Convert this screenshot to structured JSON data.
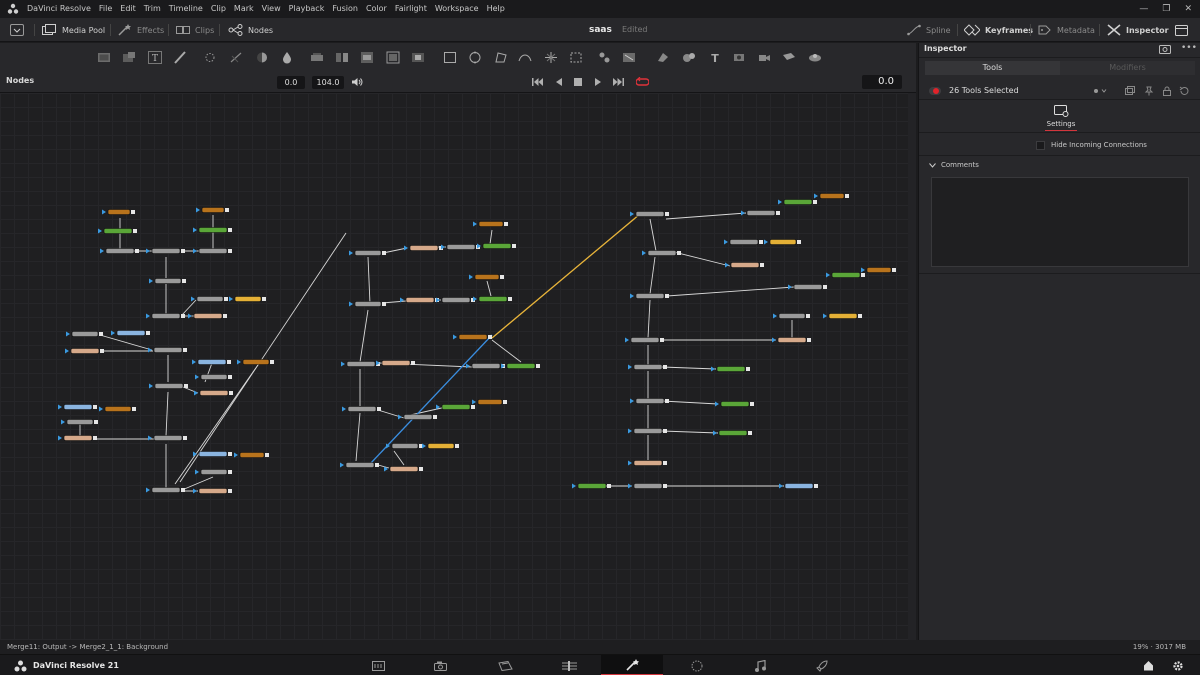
{
  "menubar": {
    "app_name": "DaVinci Resolve",
    "items": [
      "File",
      "Edit",
      "Trim",
      "Timeline",
      "Clip",
      "Mark",
      "View",
      "Playback",
      "Fusion",
      "Color",
      "Fairlight",
      "Workspace",
      "Help"
    ]
  },
  "toolbar": {
    "media_pool": "Media Pool",
    "effects": "Effects",
    "clips": "Clips",
    "nodes": "Nodes",
    "project_title": "saas",
    "project_status": "Edited",
    "spline": "Spline",
    "keyframes": "Keyframes",
    "metadata": "Metadata",
    "inspector": "Inspector"
  },
  "nodes_panel": {
    "label": "Nodes",
    "render_start": "0.0",
    "render_end": "104.0",
    "current_time": "0.0"
  },
  "inspector": {
    "title": "Inspector",
    "tabs": [
      "Tools",
      "Modifiers"
    ],
    "selection": "26 Tools Selected",
    "settings_tab": "Settings",
    "hide_incoming": "Hide Incoming Connections",
    "comments": "Comments"
  },
  "statusbar": {
    "message": "Merge11: Output -> Merge2_1_1: Background",
    "memory": "19% · 3017 MB"
  },
  "pagebar": {
    "brand": "DaVinci Resolve 21",
    "pages": [
      "Media",
      "Cut",
      "Edit",
      "Fusion",
      "Color",
      "Fairlight",
      "Deliver"
    ],
    "active_page": "Fusion"
  },
  "colors": {
    "accent": "#d2363d",
    "node_gray": "#9a9a9a",
    "node_tan": "#d6a98a",
    "node_green": "#5aa638",
    "node_orange": "#b8731c",
    "node_blue": "#8ab4e0",
    "node_yellow": "#e4b036",
    "wire_yellow": "#e8b43a",
    "wire_blue": "#3a8ee0"
  }
}
